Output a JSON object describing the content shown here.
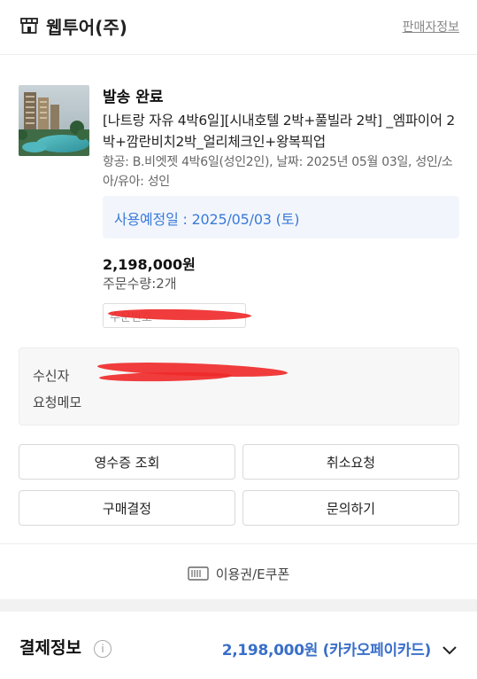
{
  "header": {
    "store_name": "웹투어(주)",
    "seller_info_link": "판매자정보"
  },
  "order": {
    "status": "발송 완료",
    "product_title": "[나트랑 자유 4박6일][시내호텔 2박+풀빌라 2박] _엠파이어 2박+깜란비치2박_얼리체크인+왕복픽업",
    "options": "항공: B.비엣젯 4박6일(성인2인), 날짜: 2025년 05월 03일, 성인/소아/유아: 성인",
    "use_date": "사용예정일 : 2025/05/03 (토)",
    "price": "2,198,000원",
    "quantity": "주문수량:2개",
    "order_number_label": "주문번호"
  },
  "delivery": {
    "recipient_label": "수신자",
    "memo_label": "요청메모"
  },
  "buttons": {
    "receipt": "영수증 조회",
    "cancel_request": "취소요청",
    "confirm_purchase": "구매결정",
    "inquiry": "문의하기"
  },
  "coupon": {
    "label": "이용권/E쿠폰"
  },
  "payment": {
    "title": "결제정보",
    "summary": "2,198,000원 (카카오페이카드)"
  },
  "colors": {
    "accent_blue": "#3a7ad9",
    "date_box_bg": "#f2f6fc",
    "redaction_red": "#ef2b2b"
  }
}
